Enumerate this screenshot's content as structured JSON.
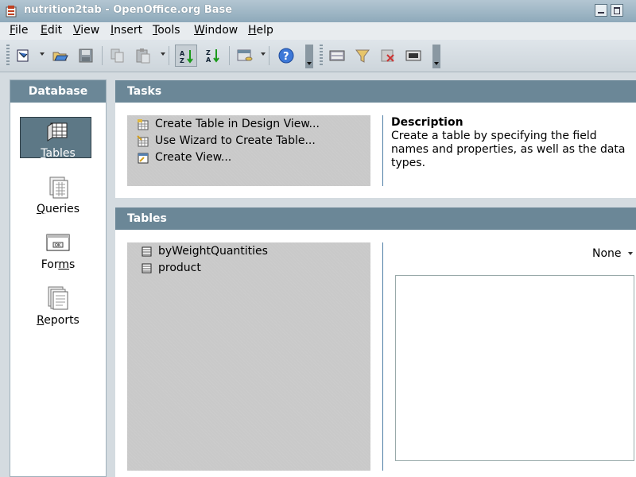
{
  "window": {
    "title": "nutrition2tab - OpenOffice.org Base"
  },
  "menu": {
    "items": [
      {
        "label": "File",
        "mnemonic": "F",
        "rest": "ile"
      },
      {
        "label": "Edit",
        "mnemonic": "E",
        "rest": "dit"
      },
      {
        "label": "View",
        "mnemonic": "V",
        "rest": "iew"
      },
      {
        "label": "Insert",
        "mnemonic": "I",
        "rest": "nsert"
      },
      {
        "label": "Tools",
        "mnemonic": "T",
        "rest": "ools"
      },
      {
        "label": "Window",
        "mnemonic": "W",
        "rest": "indow"
      },
      {
        "label": "Help",
        "mnemonic": "H",
        "rest": "elp"
      }
    ]
  },
  "toolbar": {
    "icons": [
      "new-icon",
      "open-icon",
      "save-icon",
      "copy-icon",
      "paste-icon",
      "sort-ascending-icon",
      "sort-descending-icon",
      "database-icon",
      "help-icon",
      "form-icon",
      "query-icon",
      "delete-icon",
      "report-icon"
    ]
  },
  "database_panel": {
    "header": "Database",
    "items": [
      {
        "label": "Tables",
        "mnemonic": "T",
        "rest": "ables",
        "selected": true
      },
      {
        "label": "Queries",
        "mnemonic": "Q",
        "rest": "ueries",
        "selected": false
      },
      {
        "label": "Forms",
        "mnemonic": "m",
        "pre": "For",
        "rest": "s",
        "selected": false
      },
      {
        "label": "Reports",
        "mnemonic": "R",
        "rest": "eports",
        "selected": false
      }
    ]
  },
  "tasks": {
    "header": "Tasks",
    "items": [
      "Create Table in Design View...",
      "Use Wizard to Create Table...",
      "Create View..."
    ],
    "description_title": "Description",
    "description_text": "Create a table by specifying the field names and properties, as well as the data types."
  },
  "tables": {
    "header": "Tables",
    "items": [
      "byWeightQuantities",
      "product"
    ],
    "preview_mode": "None"
  },
  "colors": {
    "section_header": "#6b8797",
    "selected_item": "#5d7886",
    "list_background": "#c9c9c9",
    "divider": "#4f7ea6"
  }
}
